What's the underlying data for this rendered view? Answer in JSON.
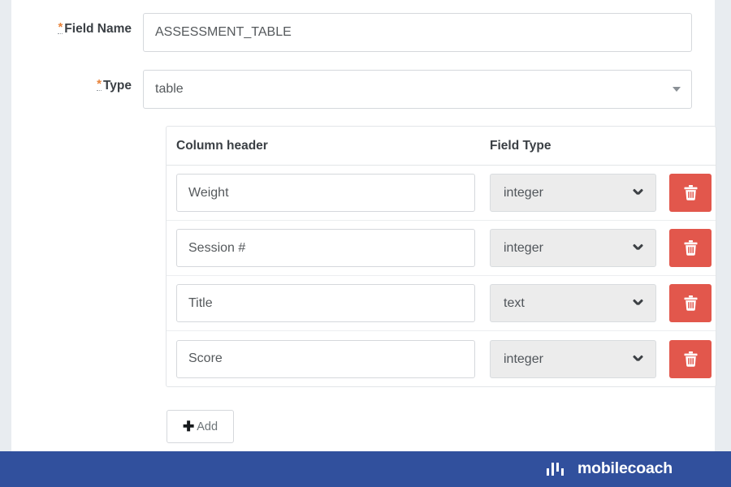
{
  "form": {
    "field_name": {
      "required_marker": "*",
      "label": "Field Name",
      "value": "ASSESSMENT_TABLE",
      "placeholder": ""
    },
    "type": {
      "required_marker": "*",
      "label": "Type",
      "value": "table",
      "caret_icon": "caret-down-icon"
    }
  },
  "table": {
    "headers": {
      "column_header": "Column header",
      "field_type": "Field Type"
    },
    "rows": [
      {
        "column_header": "Weight",
        "field_type": "integer",
        "delete_icon": "trash-icon",
        "chevron_icon": "chevron-down-icon"
      },
      {
        "column_header": "Session #",
        "field_type": "integer",
        "delete_icon": "trash-icon",
        "chevron_icon": "chevron-down-icon"
      },
      {
        "column_header": "Title",
        "field_type": "text",
        "delete_icon": "trash-icon",
        "chevron_icon": "chevron-down-icon"
      },
      {
        "column_header": "Score",
        "field_type": "integer",
        "delete_icon": "trash-icon",
        "chevron_icon": "chevron-down-icon"
      }
    ]
  },
  "add_button": {
    "plus_icon": "plus-icon",
    "label": "Add"
  },
  "footer": {
    "logo_icon": "bar-chart-logo-icon",
    "brand": "mobilecoach",
    "background_color": "#31509d"
  },
  "colors": {
    "delete_red": "#e2574c",
    "required_orange": "#e8833a",
    "footer_blue": "#31509d",
    "page_gray": "#e8ecf0"
  }
}
